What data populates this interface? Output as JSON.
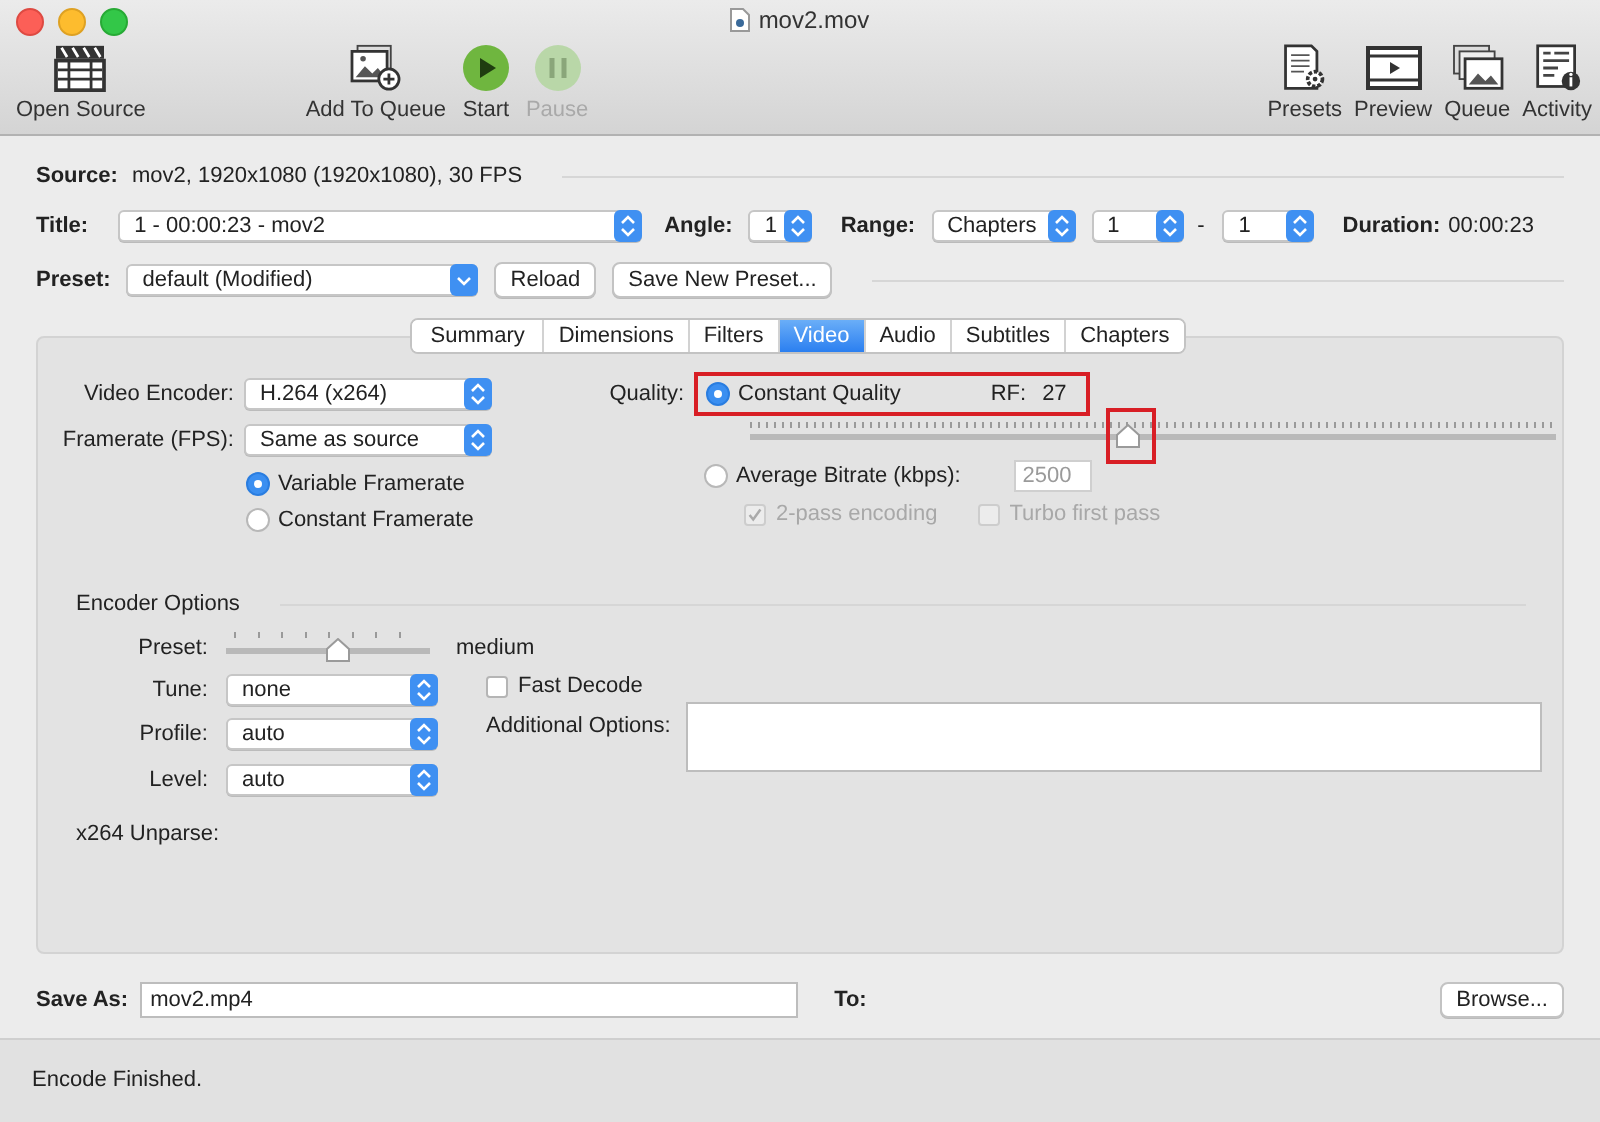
{
  "window": {
    "title": "mov2.mov"
  },
  "toolbar": {
    "left": [
      {
        "label": "Open Source",
        "kind": "clapper",
        "disabled": false
      },
      {
        "label": "Add To Queue",
        "kind": "photo-add",
        "disabled": false
      },
      {
        "label": "Start",
        "kind": "play",
        "disabled": false
      },
      {
        "label": "Pause",
        "kind": "pause",
        "disabled": true
      }
    ],
    "right": [
      {
        "label": "Presets",
        "kind": "doc-gear",
        "disabled": false
      },
      {
        "label": "Preview",
        "kind": "film",
        "disabled": false
      },
      {
        "label": "Queue",
        "kind": "photos",
        "disabled": false
      },
      {
        "label": "Activity",
        "kind": "doc-info",
        "disabled": false
      }
    ]
  },
  "source": {
    "label": "Source:",
    "value": "mov2, 1920x1080 (1920x1080), 30 FPS"
  },
  "title_row": {
    "title_label": "Title:",
    "title_value": "1 - 00:00:23 - mov2",
    "angle_label": "Angle:",
    "angle_value": "1",
    "range_label": "Range:",
    "range_value": "Chapters",
    "range_from": "1",
    "range_sep": "-",
    "range_to": "1",
    "duration_label": "Duration:",
    "duration_value": "00:00:23"
  },
  "preset_row": {
    "label": "Preset:",
    "value": "default (Modified)",
    "buttons": [
      "Reload",
      "Save New Preset..."
    ]
  },
  "tabs": [
    {
      "label": "Summary",
      "selected": false
    },
    {
      "label": "Dimensions",
      "selected": false
    },
    {
      "label": "Filters",
      "selected": false
    },
    {
      "label": "Video",
      "selected": true
    },
    {
      "label": "Audio",
      "selected": false
    },
    {
      "label": "Subtitles",
      "selected": false
    },
    {
      "label": "Chapters",
      "selected": false
    }
  ],
  "video": {
    "encoder_label": "Video Encoder:",
    "encoder_value": "H.264 (x264)",
    "framerate_label": "Framerate (FPS):",
    "framerate_value": "Same as source",
    "framerate_modes": [
      {
        "label": "Variable Framerate",
        "selected": true
      },
      {
        "label": "Constant Framerate",
        "selected": false
      }
    ],
    "quality_label": "Quality:",
    "constant_quality": {
      "label": "Constant Quality",
      "selected": true,
      "highlighted": true,
      "rf_label": "RF:",
      "rf_value": "27"
    },
    "quality_slider": {
      "level": 0.47,
      "highlighted": true
    },
    "average_bitrate": {
      "label": "Average Bitrate (kbps):",
      "selected": false,
      "placeholder": "2500"
    },
    "bitrate_options": [
      {
        "label": "2-pass encoding",
        "checked": true,
        "disabled": true
      },
      {
        "label": "Turbo first pass",
        "checked": false,
        "disabled": true
      }
    ]
  },
  "encoder_options": {
    "title": "Encoder Options",
    "preset_label": "Preset:",
    "preset_slider": {
      "level": 0.55
    },
    "preset_value": "medium",
    "tune_label": "Tune:",
    "tune_value": "none",
    "fast_decode": {
      "label": "Fast Decode",
      "checked": false
    },
    "profile_label": "Profile:",
    "profile_value": "auto",
    "level_label": "Level:",
    "level_value": "auto",
    "additional_label": "Additional Options:",
    "unparse_label": "x264 Unparse:"
  },
  "save": {
    "label": "Save As:",
    "value": "mov2.mp4",
    "to_label": "To:",
    "button": "Browse..."
  },
  "status_bar": "Encode Finished."
}
